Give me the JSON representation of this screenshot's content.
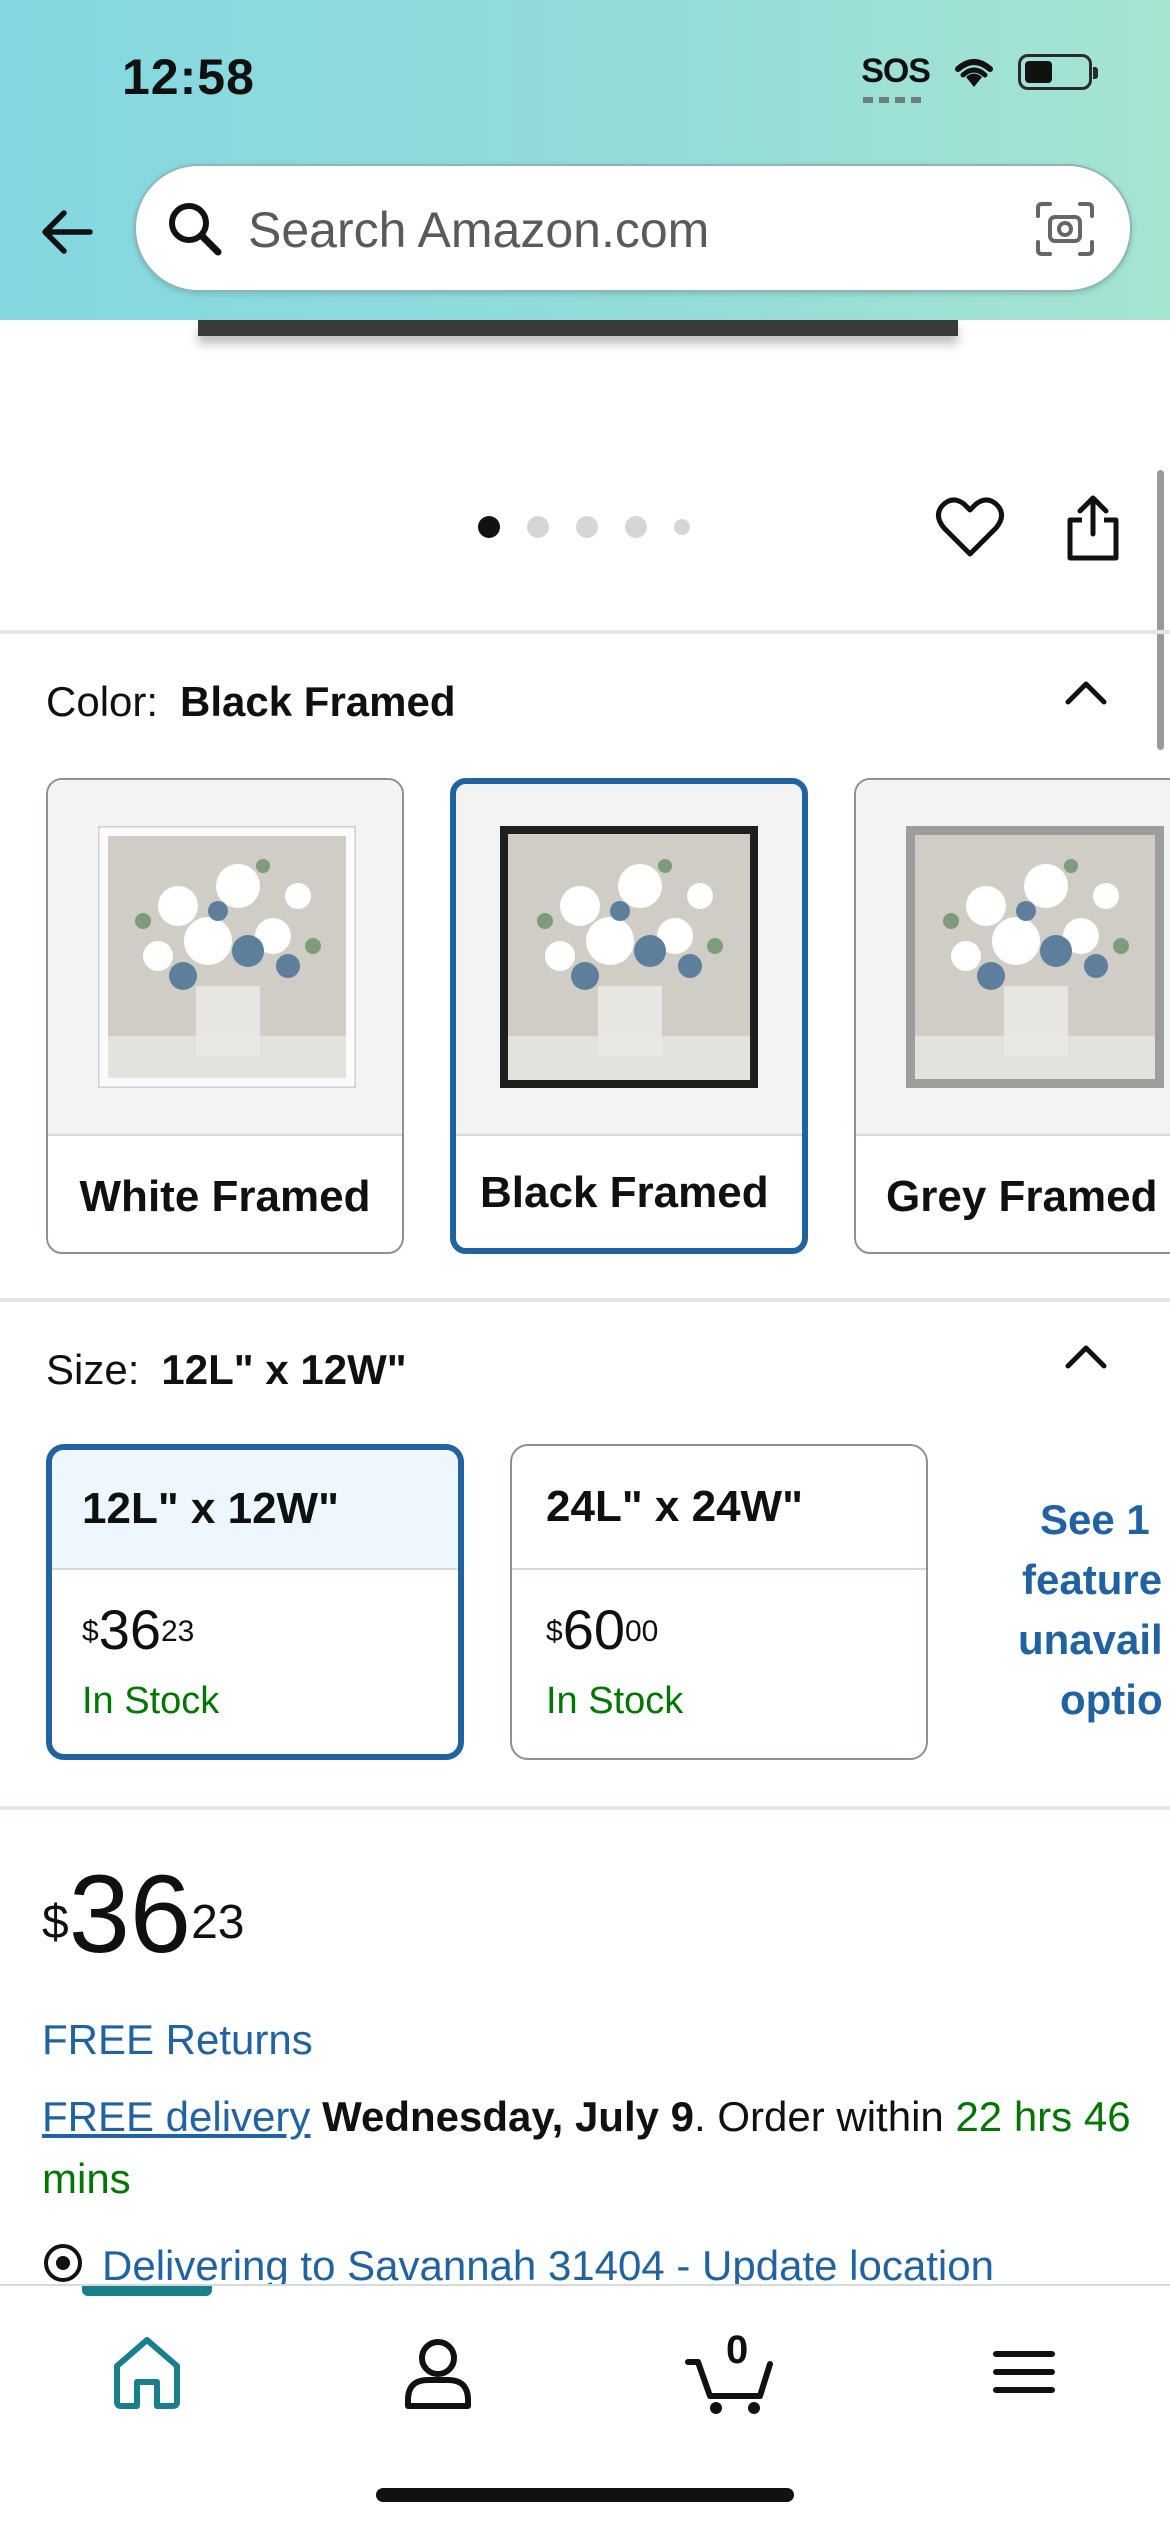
{
  "status_bar": {
    "time": "12:58",
    "sos": "SOS",
    "battery_level_pct": 45
  },
  "search": {
    "placeholder": "Search Amazon.com"
  },
  "gallery": {
    "dot_count": 5,
    "active_index": 0
  },
  "color": {
    "label": "Color:",
    "selected": "Black Framed",
    "options": [
      {
        "name": "White Framed",
        "selected": false
      },
      {
        "name": "Black Framed",
        "selected": true
      },
      {
        "name": "Grey Framed",
        "selected": false
      }
    ]
  },
  "size": {
    "label": "Size:",
    "selected": "12L\" x 12W\"",
    "options": [
      {
        "name": "12L\" x 12W\"",
        "currency": "$",
        "price_whole": "36",
        "price_cents": "23",
        "stock": "In Stock",
        "selected": true
      },
      {
        "name": "24L\" x 24W\"",
        "currency": "$",
        "price_whole": "60",
        "price_cents": "00",
        "stock": "In Stock",
        "selected": false
      }
    ],
    "see_unavailable": [
      "See 1",
      "feature",
      "unavail",
      "optio"
    ]
  },
  "price": {
    "currency": "$",
    "whole": "36",
    "cents": "23"
  },
  "delivery": {
    "free_returns": "FREE Returns",
    "free_delivery_link": "FREE delivery",
    "date": "Wednesday, July 9",
    "order_within_prefix": ". Order within ",
    "countdown": "22 hrs 46 mins",
    "location": "Delivering to Savannah 31404 - Update location"
  },
  "bottom_nav": {
    "cart_count": "0",
    "active": "home"
  },
  "colors": {
    "header_gradient_start": "#84d8e1",
    "header_gradient_end": "#a6e4d2",
    "selected_border": "#2162a1",
    "link_blue": "#2162a1",
    "in_stock_green": "#007600",
    "nav_active": "#1a7f8a"
  }
}
